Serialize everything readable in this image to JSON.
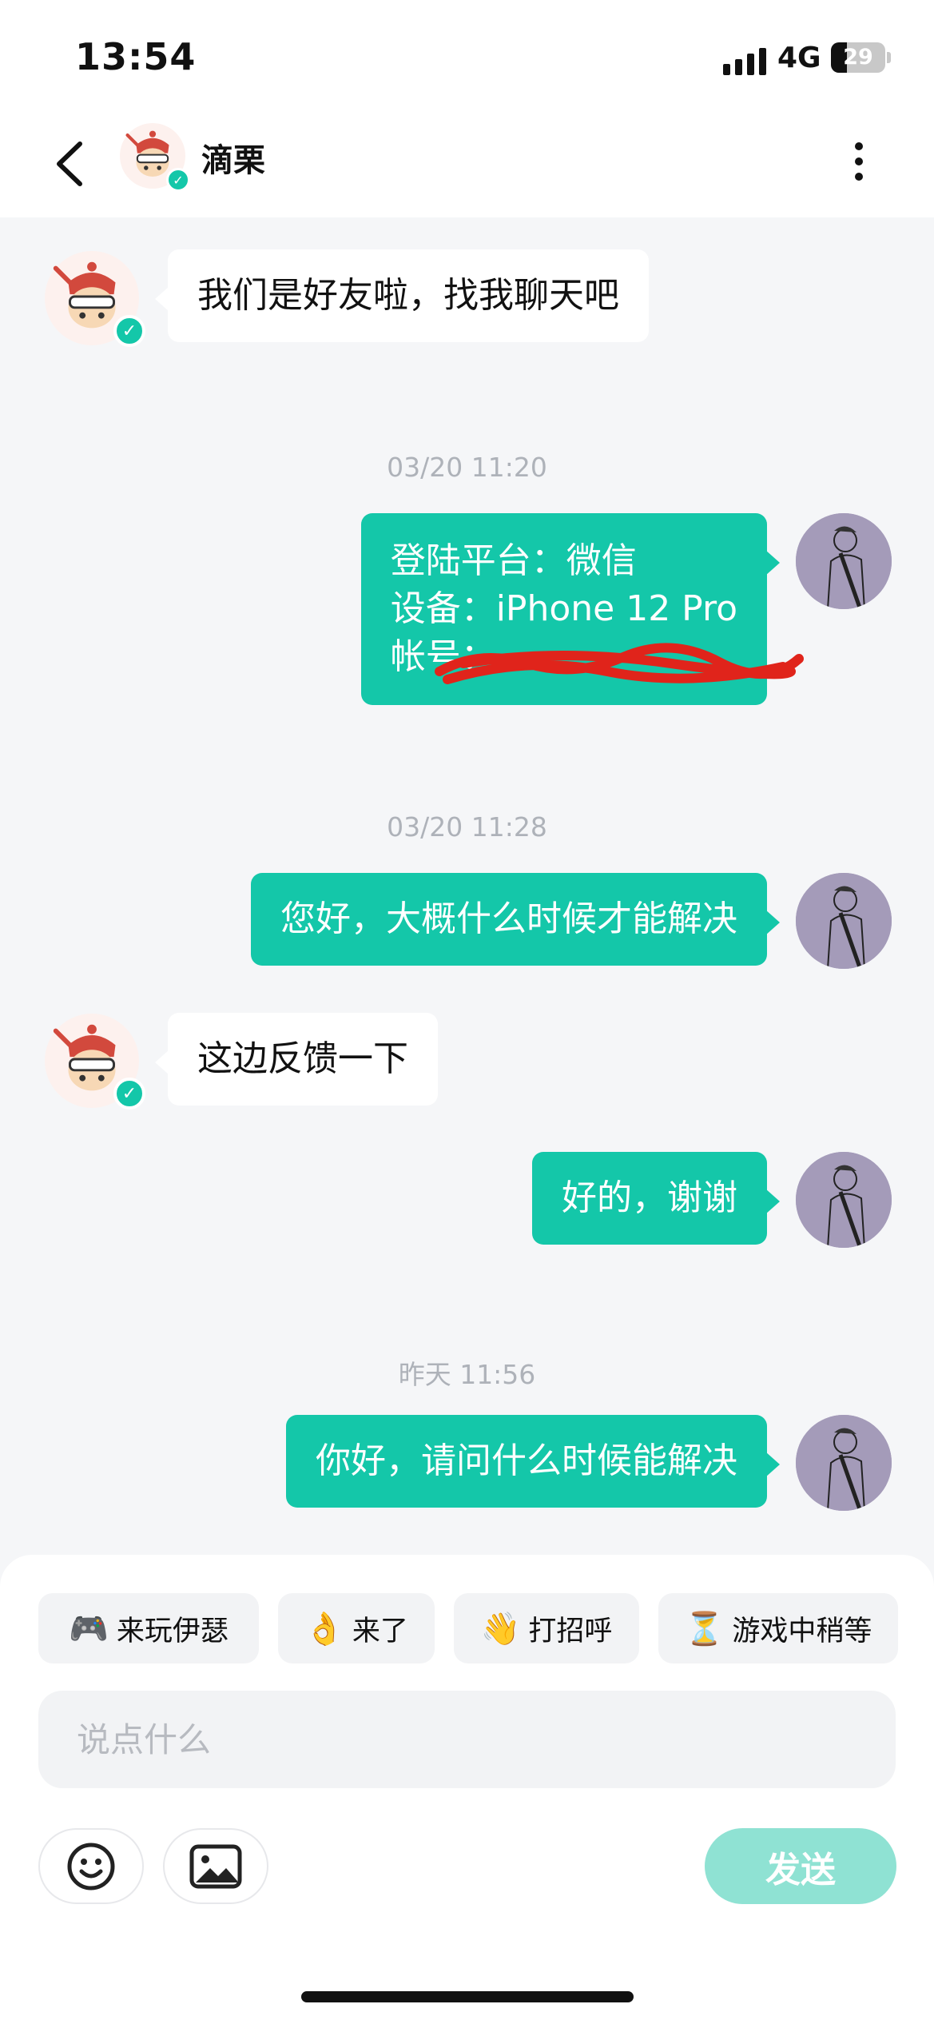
{
  "status_bar": {
    "time": "13:54",
    "network": "4G",
    "battery": "29",
    "battery_level": 0.29
  },
  "header": {
    "contact_name": "滴栗"
  },
  "messages": [
    {
      "side": "left",
      "text": "我们是好友啦，找我聊天吧"
    },
    {
      "timestamp": "03/20 11:20"
    },
    {
      "side": "right",
      "lines": [
        "登陆平台：微信",
        "设备：iPhone 12 Pro",
        "帐号："
      ]
    },
    {
      "timestamp": "03/20 11:28"
    },
    {
      "side": "right",
      "text": "您好，大概什么时候才能解决"
    },
    {
      "side": "left",
      "text": "这边反馈一下"
    },
    {
      "side": "right",
      "text": "好的，谢谢"
    },
    {
      "timestamp": "昨天 11:56"
    },
    {
      "side": "right",
      "text": "你好，请问什么时候能解决"
    }
  ],
  "quick_replies": [
    {
      "emoji": "🎮",
      "label": "来玩伊瑟"
    },
    {
      "emoji": "👌",
      "label": "来了"
    },
    {
      "emoji": "👋",
      "label": "打招呼"
    },
    {
      "emoji": "⏳",
      "label": "游戏中稍等"
    }
  ],
  "composer": {
    "placeholder": "说点什么",
    "send_label": "发送"
  },
  "colors": {
    "accent": "#14c7a9",
    "send_disabled": "#8fe2d3",
    "background": "#f5f6f8"
  },
  "icons": [
    "back-icon",
    "more-icon",
    "verified-icon",
    "emoji-icon",
    "image-icon"
  ]
}
